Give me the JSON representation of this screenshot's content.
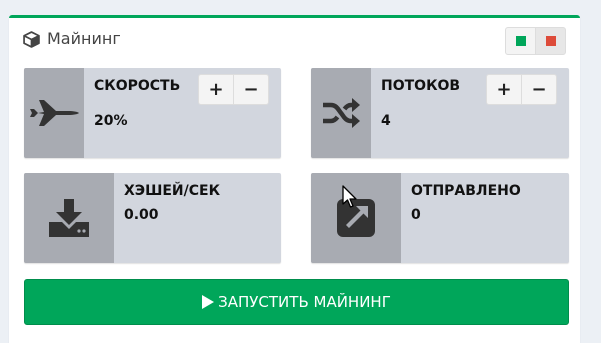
{
  "panel": {
    "title": "Майнинг",
    "title_icon": "cube-icon",
    "header_buttons": [
      {
        "name": "start-indicator-button",
        "color": "#00a65a"
      },
      {
        "name": "stop-indicator-button",
        "color": "#dd4b39"
      }
    ]
  },
  "speed": {
    "label": "Скорость",
    "value": "20%",
    "icon": "fighter-jet-icon",
    "increase_label": "+",
    "decrease_label": "−"
  },
  "threads": {
    "label": "Потоков",
    "value": "4",
    "icon": "random-icon",
    "increase_label": "+",
    "decrease_label": "−"
  },
  "hashes": {
    "label": "Хэшей/сек",
    "value": "0.00",
    "icon": "download-icon"
  },
  "sent": {
    "label": "Отправлено",
    "value": "0",
    "icon": "external-link-icon"
  },
  "start_button": {
    "label": "ЗАПУСТИТЬ МАЙНИНГ",
    "icon": "play-icon"
  },
  "colors": {
    "accent": "#00a65a",
    "info_box": "#d2d6de",
    "icon_bg": "#a8abb2",
    "icon_fg": "#333333"
  }
}
